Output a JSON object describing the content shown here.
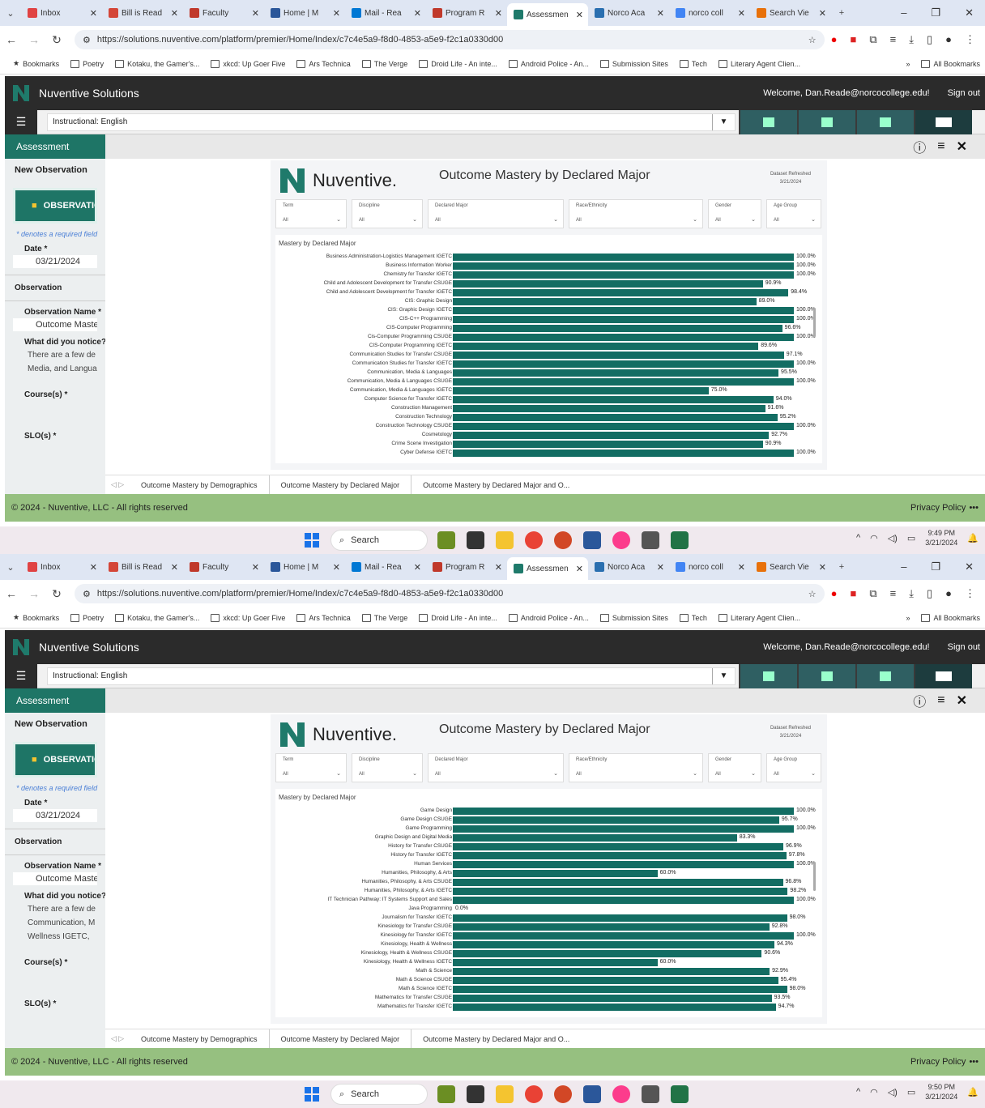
{
  "browser": {
    "tabs": [
      {
        "label": "Inbox",
        "color": "#e04343"
      },
      {
        "label": "Bill is Read",
        "color": "#d44638"
      },
      {
        "label": "Faculty",
        "color": "#c0392b"
      },
      {
        "label": "Home | M",
        "color": "#2b579a"
      },
      {
        "label": "Mail - Rea",
        "color": "#0078d4"
      },
      {
        "label": "Program R",
        "color": "#c0392b"
      },
      {
        "label": "Assessmen",
        "color": "#1f7a6b"
      },
      {
        "label": "Norco Aca",
        "color": "#2a6fb0"
      },
      {
        "label": "norco coll",
        "color": "#4285f4"
      },
      {
        "label": "Search Vie",
        "color": "#e8710a"
      }
    ],
    "url": "https://solutions.nuventive.com/platform/premier/Home/Index/c7c4e5a9-f8d0-4853-a5e9-f2c1a0330d00",
    "bookmarks": [
      "Bookmarks",
      "Poetry",
      "Kotaku, the Gamer's...",
      "xkcd: Up Goer Five",
      "Ars Technica",
      "The Verge",
      "Droid Life - An inte...",
      "Android Police - An...",
      "Submission Sites",
      "Tech",
      "Literary Agent Clien..."
    ],
    "bookmarks_more": "»",
    "all_bookmarks": "All Bookmarks"
  },
  "app": {
    "brand": "Nuventive Solutions",
    "welcome": "Welcome, Dan.Reade@norcocollege.edu!",
    "signout": "Sign out",
    "context": "Instructional: English",
    "section": "Assessment",
    "new_observation": "New Observation",
    "observation_btn": "OBSERVATION",
    "required_note": "* denotes a required field",
    "date_label": "Date *",
    "date_value": "03/21/2024",
    "observation_header": "Observation",
    "obs_name_label": "Observation Name *",
    "obs_name_value": "Outcome Mastery",
    "notice_label": "What did you notice?",
    "course_label": "Course(s) *",
    "slo_label": "SLO(s) *",
    "footer_copy": "© 2024 - Nuventive, LLC - All rights reserved",
    "privacy": "Privacy Policy",
    "privacy_more": "•••"
  },
  "report": {
    "brand": "Nuventive.",
    "title": "Outcome Mastery by Declared Major",
    "dataset_label": "Dataset Refreshed",
    "dataset_date": "3/21/2024",
    "filters": [
      {
        "label": "Term",
        "value": "All"
      },
      {
        "label": "Discipline",
        "value": "All"
      },
      {
        "label": "Declared Major",
        "value": "All"
      },
      {
        "label": "Race/Ethnicity",
        "value": "All"
      },
      {
        "label": "Gender",
        "value": "All"
      },
      {
        "label": "Age Group",
        "value": "All"
      }
    ],
    "chart_title": "Mastery by Declared Major",
    "tabs": [
      "Outcome Mastery by Demographics",
      "Outcome Mastery by Declared Major",
      "Outcome Mastery by Declared Major and O..."
    ]
  },
  "screens": [
    {
      "notice_text": [
        "There are a few de",
        "Media, and Langua"
      ],
      "time": "9:49 PM",
      "date": "3/21/2024"
    },
    {
      "notice_text": [
        "There are a few de",
        "Communication, M",
        "Wellness IGETC,"
      ],
      "time": "9:50 PM",
      "date": "3/21/2024"
    }
  ],
  "taskbar": {
    "search": "Search"
  },
  "chart_data": [
    {
      "type": "bar",
      "orientation": "horizontal",
      "title": "Mastery by Declared Major",
      "xlim": [
        0,
        100
      ],
      "categories": [
        "Business Administration-Logistics Management IGETC",
        "Business Information Worker",
        "Chemistry for Transfer IGETC",
        "Child and Adolescent Development for Transfer CSUGE",
        "Child and Adolescent Development for Transfer IGETC",
        "CIS: Graphic Design",
        "CIS: Graphic Design IGETC",
        "CIS-C++ Programming",
        "CIS-Computer Programming",
        "Cis-Computer Programming CSUGE",
        "CIS-Computer Programming IGETC",
        "Communication Studies for Transfer CSUGE",
        "Communication Studies for Transfer IGETC",
        "Communication, Media & Languages",
        "Communication, Media & Languages CSUGE",
        "Communication, Media & Languages IGETC",
        "Computer Science for Transfer IGETC",
        "Construction Management",
        "Construction Technology",
        "Construction Technology CSUGE",
        "Cosmetology",
        "Crime Scene Investigation",
        "Cyber Defense IGETC"
      ],
      "values": [
        100.0,
        100.0,
        100.0,
        90.9,
        98.4,
        89.0,
        100.0,
        100.0,
        96.6,
        100.0,
        89.6,
        97.1,
        100.0,
        95.5,
        100.0,
        75.0,
        94.0,
        91.6,
        95.2,
        100.0,
        92.7,
        90.9,
        100.0
      ],
      "labels": [
        "100.0%",
        "100.0%",
        "100.0%",
        "90.9%",
        "98.4%",
        "89.0%",
        "100.0%",
        "100.0%",
        "96.6%",
        "100.0%",
        "89.6%",
        "97.1%",
        "100.0%",
        "95.5%",
        "100.0%",
        "75.0%",
        "94.0%",
        "91.6%",
        "95.2%",
        "100.0%",
        "92.7%",
        "90.9%",
        "100.0%"
      ]
    },
    {
      "type": "bar",
      "orientation": "horizontal",
      "title": "Mastery by Declared Major",
      "xlim": [
        0,
        100
      ],
      "categories": [
        "Game Design",
        "Game Design CSUGE",
        "Game Programming",
        "Graphic Design and Digital Media",
        "History for Transfer CSUGE",
        "History for Transfer IGETC",
        "Human Services",
        "Humanities, Philosophy, & Arts",
        "Humanities, Philosophy, & Arts CSUGE",
        "Humanities, Philosophy, & Arts IGETC",
        "IT Technician Pathway: IT Systems Support and Sales",
        "Java Programming",
        "Journalism for Transfer IGETC",
        "Kinesiology for Transfer CSUGE",
        "Kinesiology for Transfer IGETC",
        "Kinesiology, Health & Wellness",
        "Kinesiology, Health & Wellness CSUGE",
        "Kinesiology, Health & Wellness IGETC",
        "Math & Science",
        "Math & Science CSUGE",
        "Math & Science IGETC",
        "Mathematics for Transfer CSUGE",
        "Mathematics for Transfer IGETC"
      ],
      "values": [
        100.0,
        95.7,
        100.0,
        83.3,
        96.9,
        97.8,
        100.0,
        60.0,
        96.8,
        98.2,
        100.0,
        0.0,
        98.0,
        92.8,
        100.0,
        94.3,
        90.6,
        60.0,
        92.9,
        95.4,
        98.0,
        93.5,
        94.7
      ],
      "labels": [
        "100.0%",
        "95.7%",
        "100.0%",
        "83.3%",
        "96.9%",
        "97.8%",
        "100.0%",
        "60.0%",
        "96.8%",
        "98.2%",
        "100.0%",
        "0.0%",
        "98.0%",
        "92.8%",
        "100.0%",
        "94.3%",
        "90.6%",
        "60.0%",
        "92.9%",
        "95.4%",
        "98.0%",
        "93.5%",
        "94.7%"
      ]
    }
  ]
}
